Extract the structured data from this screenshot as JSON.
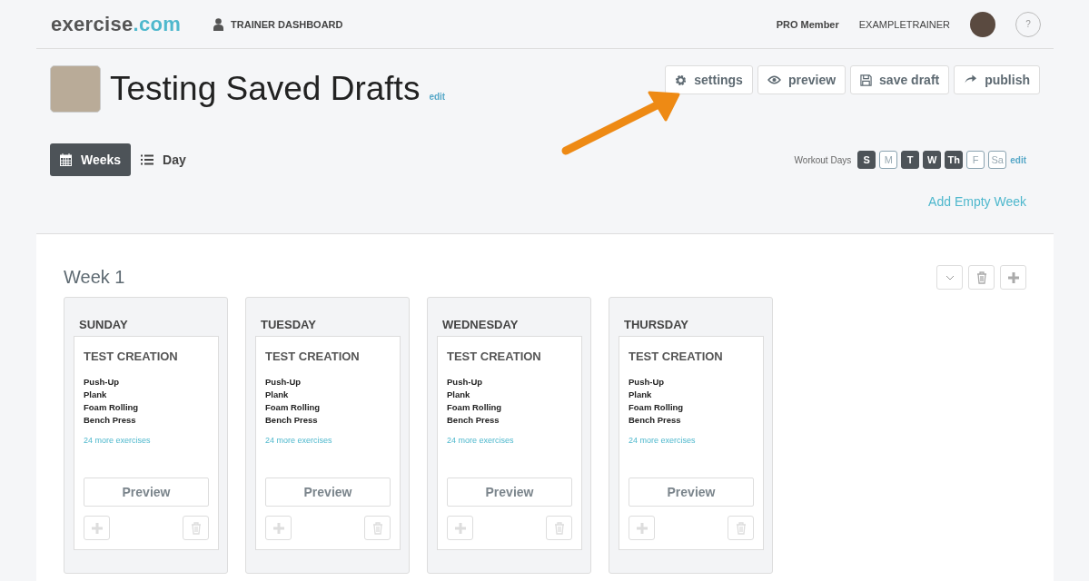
{
  "header": {
    "logo_main": "exercise",
    "logo_accent": ".com",
    "nav_link": "TRAINER DASHBOARD",
    "membership": "PRO Member",
    "username": "EXAMPLETRAINER",
    "help": "?"
  },
  "program": {
    "title": "Testing Saved Drafts",
    "edit": "edit"
  },
  "actions": [
    {
      "kind": "gear",
      "label": "settings"
    },
    {
      "kind": "eye",
      "label": "preview"
    },
    {
      "kind": "disk",
      "label": "save draft"
    },
    {
      "kind": "share",
      "label": "publish"
    }
  ],
  "view_tabs": [
    {
      "kind": "calendar",
      "label": "Weeks",
      "selected": true
    },
    {
      "kind": "list",
      "label": "Day",
      "selected": false
    }
  ],
  "workout_days": {
    "label": "Workout Days",
    "edit": "edit",
    "days": [
      {
        "label": "S",
        "on": true
      },
      {
        "label": "M",
        "on": false
      },
      {
        "label": "T",
        "on": true
      },
      {
        "label": "W",
        "on": true
      },
      {
        "label": "Th",
        "on": true
      },
      {
        "label": "F",
        "on": false
      },
      {
        "label": "Sa",
        "on": false
      }
    ]
  },
  "add_week": "Add Empty Week",
  "week": {
    "title": "Week 1",
    "days": [
      {
        "day": "SUNDAY",
        "workout": "TEST CREATION",
        "exercises": [
          "Push-Up",
          "Plank",
          "Foam Rolling",
          "Bench Press"
        ],
        "more": "24 more exercises",
        "button": "Preview"
      },
      {
        "day": "TUESDAY",
        "workout": "TEST CREATION",
        "exercises": [
          "Push-Up",
          "Plank",
          "Foam Rolling",
          "Bench Press"
        ],
        "more": "24 more exercises",
        "button": "Preview"
      },
      {
        "day": "WEDNESDAY",
        "workout": "TEST CREATION",
        "exercises": [
          "Push-Up",
          "Plank",
          "Foam Rolling",
          "Bench Press"
        ],
        "more": "24 more exercises",
        "button": "Preview"
      },
      {
        "day": "THURSDAY",
        "workout": "TEST CREATION",
        "exercises": [
          "Push-Up",
          "Plank",
          "Foam Rolling",
          "Bench Press"
        ],
        "more": "24 more exercises",
        "button": "Preview"
      }
    ]
  }
}
